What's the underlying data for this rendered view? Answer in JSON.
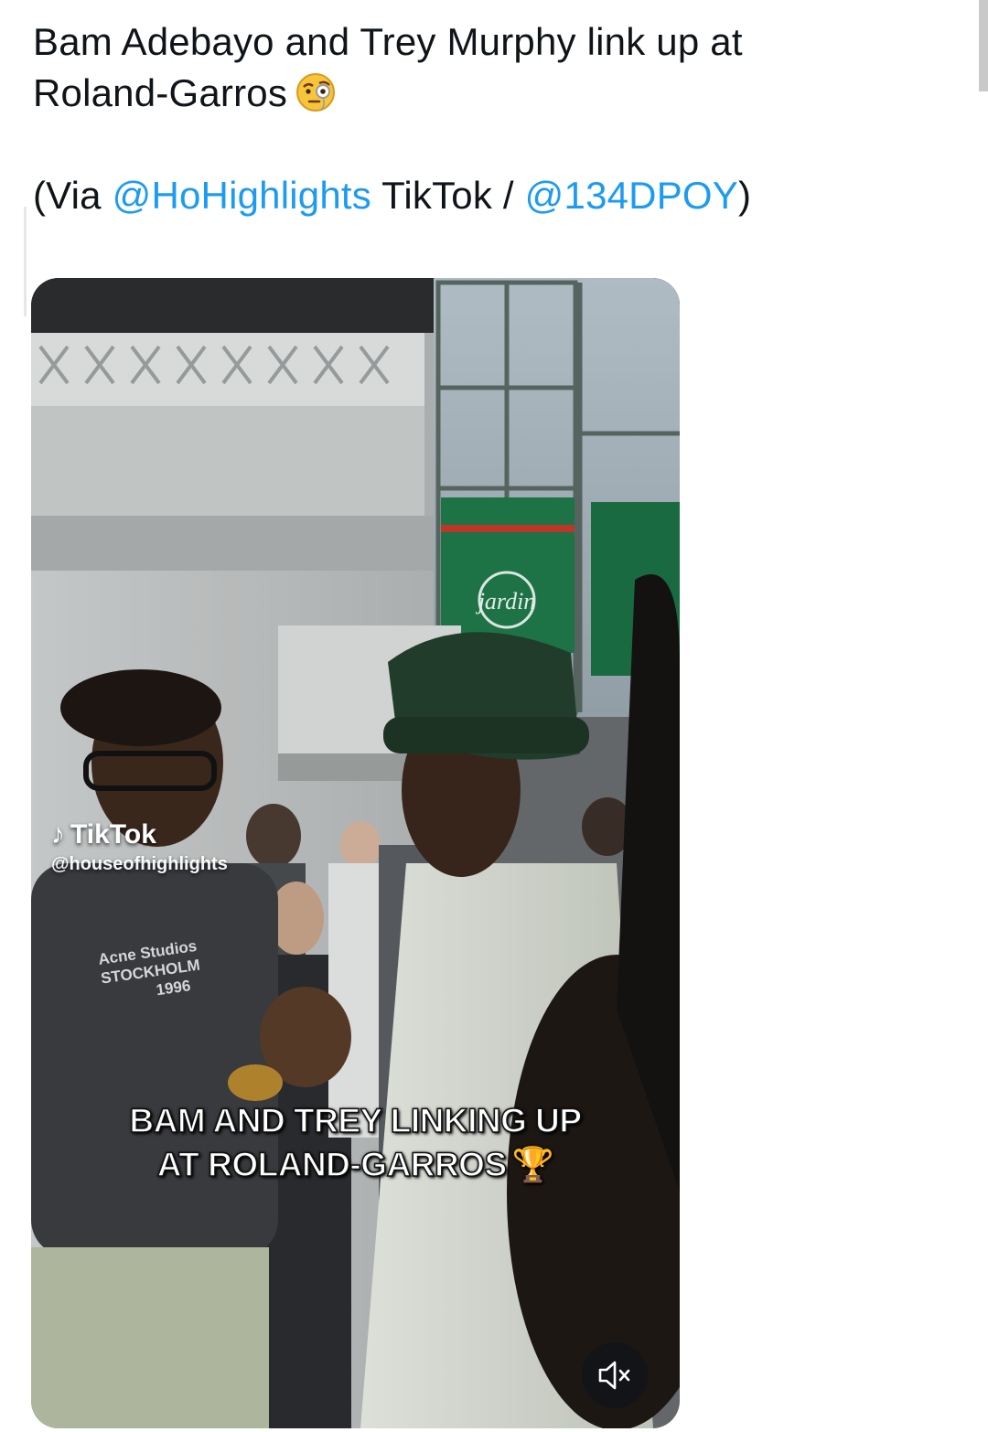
{
  "tweet": {
    "text_line1": "Bam Adebayo and Trey Murphy link up at",
    "text_line2": "Roland-Garros",
    "text_emoji": "face-with-monocle-emoji",
    "via_prefix": "(Via ",
    "via_mention1": "@HoHighlights",
    "via_middle": " TikTok / ",
    "via_mention2": "@134DPOY",
    "via_suffix": ")"
  },
  "video": {
    "watermark_brand": "TikTok",
    "watermark_handle": "@houseofhighlights",
    "sign_text": "jardin",
    "shirt_line1": "Acne Studios",
    "shirt_line2": "STOCKHOLM",
    "shirt_line3": "1996",
    "caption_line1": "BAM AND TREY LINKING UP",
    "caption_line2": "AT ROLAND-GARROS",
    "caption_icon": "trophy-icon",
    "mute_icon": "speaker-muted-icon"
  },
  "colors": {
    "link": "#1d9bf0",
    "text": "#0f1419",
    "sign_green": "#1f7a4a",
    "hat_green": "#23402d"
  }
}
